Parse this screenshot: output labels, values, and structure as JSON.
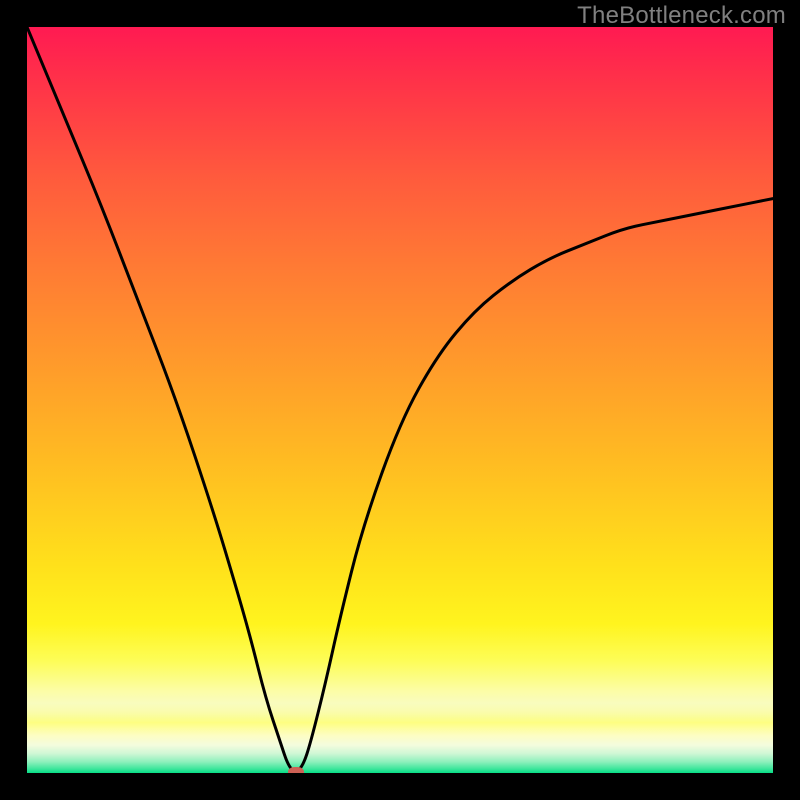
{
  "watermark": "TheBottleneck.com",
  "colors": {
    "background": "#000000",
    "gradient_top": "#ff1a52",
    "gradient_mid": "#ffe01b",
    "gradient_bottom": "#09dd87",
    "curve_stroke": "#000000",
    "marker": "#cd6155",
    "watermark_text": "#808080"
  },
  "chart_data": {
    "type": "line",
    "title": "",
    "xlabel": "",
    "ylabel": "",
    "xlim": [
      0,
      100
    ],
    "ylim": [
      0,
      100
    ],
    "series": [
      {
        "name": "bottleneck-curve",
        "x": [
          0,
          5,
          10,
          15,
          20,
          25,
          28,
          30,
          32,
          34,
          35,
          36,
          37,
          38,
          40,
          42,
          45,
          50,
          55,
          60,
          65,
          70,
          75,
          80,
          85,
          90,
          95,
          100
        ],
        "values": [
          100,
          88,
          76,
          63,
          50,
          35,
          25,
          18,
          10,
          4,
          1,
          0,
          1,
          4,
          12,
          21,
          33,
          47,
          56,
          62,
          66,
          69,
          71,
          73,
          74,
          75,
          76,
          77
        ]
      }
    ],
    "annotations": [
      {
        "name": "minimum-marker",
        "x": 36,
        "y": 0
      }
    ],
    "background_gradient": {
      "orientation": "vertical",
      "stops": [
        {
          "pos": 0.0,
          "color": "#ff1a52"
        },
        {
          "pos": 0.5,
          "color": "#ffbb22"
        },
        {
          "pos": 0.85,
          "color": "#fefe81"
        },
        {
          "pos": 1.0,
          "color": "#09dd87"
        }
      ]
    }
  }
}
